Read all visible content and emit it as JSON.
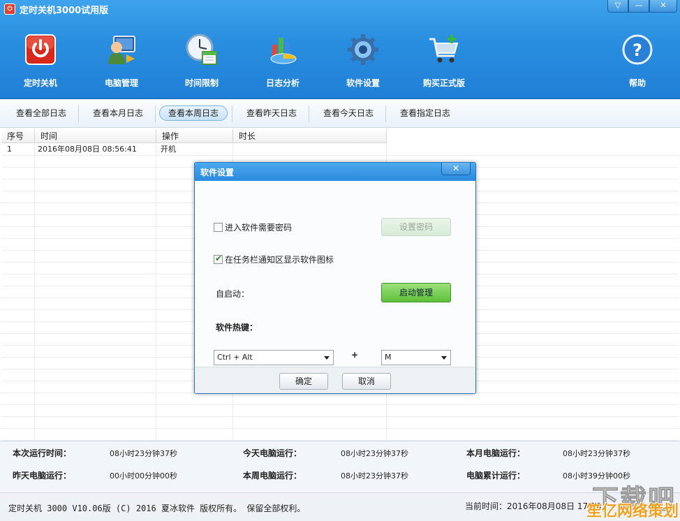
{
  "window": {
    "title": "定时关机3000试用版",
    "app_icon_glyph": "⏻"
  },
  "title_buttons": {
    "menu": "▽",
    "minimize": "—",
    "close": "✕"
  },
  "toolbar": {
    "items": [
      {
        "label": "定时关机",
        "icon": "power-icon"
      },
      {
        "label": "电脑管理",
        "icon": "computer-user-icon"
      },
      {
        "label": "时间限制",
        "icon": "clock-calendar-icon"
      },
      {
        "label": "日志分析",
        "icon": "chart-icon"
      },
      {
        "label": "软件设置",
        "icon": "gear-icon"
      },
      {
        "label": "购买正式版",
        "icon": "cart-icon"
      }
    ],
    "help_label": "帮助"
  },
  "tabs": [
    "查看全部日志",
    "查看本月日志",
    "查看本周日志",
    "查看昨天日志",
    "查看今天日志",
    "查看指定日志"
  ],
  "active_tab": "查看本周日志",
  "table": {
    "columns": [
      "序号",
      "时间",
      "操作",
      "时长"
    ],
    "rows": [
      {
        "no": "1",
        "time": "2016年08月08日 08:56:41",
        "action": "开机",
        "duration": ""
      }
    ]
  },
  "stats": {
    "this_run_label": "本次运行时间：",
    "this_run_value": "08小时23分钟37秒",
    "today_label": "今天电脑运行：",
    "today_value": "08小时23分钟37秒",
    "month_label": "本月电脑运行：",
    "month_value": "08小时23分钟37秒",
    "yesterday_label": "昨天电脑运行：",
    "yesterday_value": "00小时00分钟00秒",
    "week_label": "本周电脑运行：",
    "week_value": "08小时23分钟37秒",
    "total_label": "电脑累计运行：",
    "total_value": "08小时39分钟00秒"
  },
  "statusbar": {
    "copyright": "定时关机 3000 V10.06版 (C) 2016  夏冰软件 版权所有。 保留全部权利。",
    "current_time": "当前时间：2016年08月08日 17:20"
  },
  "watermark": {
    "big": "下载吧",
    "text": "笙亿网络策划"
  },
  "dialog": {
    "title": "软件设置",
    "close": "✕",
    "password_checkbox_label": "进入软件需要密码",
    "password_checked": false,
    "set_password_button": "设置密码",
    "tray_checkbox_label": "在任务栏通知区显示软件图标",
    "tray_checked": true,
    "autostart_label": "自启动：",
    "autostart_button": "启动管理",
    "hotkey_label": "软件热键：",
    "hotkey_modifier": "Ctrl + Alt",
    "hotkey_plus": "+",
    "hotkey_key": "M",
    "ok_button": "确定",
    "cancel_button": "取消"
  },
  "colors": {
    "header_blue": "#2a8fe0",
    "accent_green": "#5fbf3a",
    "power_red": "#e03a2a"
  }
}
